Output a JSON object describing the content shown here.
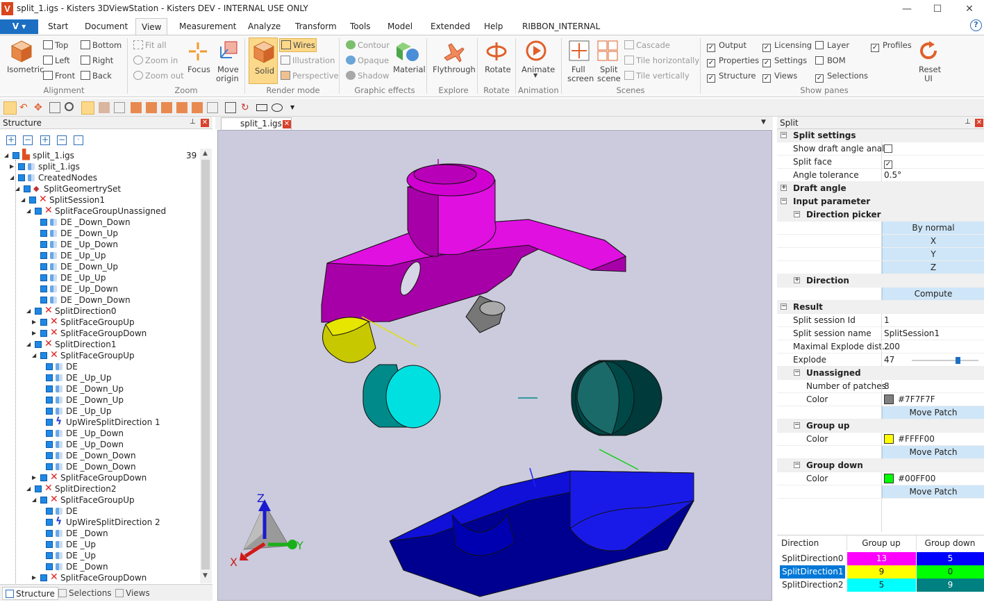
{
  "window": {
    "title": "split_1.igs - Kisters 3DViewStation - Kisters DEV - INTERNAL USE ONLY",
    "app_button": "V",
    "minimize": "—",
    "maximize": "☐",
    "close": "✕"
  },
  "ribbon_tabs": [
    "Start",
    "Document",
    "View",
    "Measurement",
    "Analyze",
    "Transform",
    "Tools",
    "Model",
    "Extended",
    "Help",
    "RIBBON_INTERNAL"
  ],
  "active_tab": "View",
  "help": "?",
  "ribbon": {
    "isometric": "Isometric",
    "top": "Top",
    "bottom": "Bottom",
    "left": "Left",
    "right": "Right",
    "front": "Front",
    "back": "Back",
    "alignment": "Alignment",
    "fit_all": "Fit all",
    "zoom_in": "Zoom in",
    "zoom_out": "Zoom out",
    "focus": "Focus",
    "move_origin_1": "Move",
    "move_origin_2": "origin",
    "zoom": "Zoom",
    "solid": "Solid",
    "wires": "Wires",
    "illustration": "Illustration",
    "perspective": "Perspective",
    "render_mode": "Render mode",
    "contour": "Contour",
    "opaque": "Opaque",
    "shadow": "Shadow",
    "material": "Material",
    "graphic_effects": "Graphic effects",
    "flythrough": "Flythrough",
    "explore": "Explore",
    "rotate": "Rotate",
    "rotate_grp": "Rotate",
    "animate": "Animate",
    "animation": "Animation",
    "full_screen_1": "Full",
    "full_screen_2": "screen",
    "split_scene_1": "Split",
    "split_scene_2": "scene",
    "cascade": "Cascade",
    "tile_h": "Tile horizontally",
    "tile_v": "Tile vertically",
    "scenes": "Scenes",
    "output": "Output",
    "licensing": "Licensing",
    "layer": "Layer",
    "profiles": "Profiles",
    "properties": "Properties",
    "settings": "Settings",
    "bom": "BOM",
    "structure": "Structure",
    "views": "Views",
    "selections": "Selections",
    "reset_1": "Reset",
    "reset_2": "UI",
    "show_panes": "Show panes",
    "checks": {
      "output": true,
      "licensing": true,
      "layer": false,
      "profiles": true,
      "properties": true,
      "settings": true,
      "bom": false,
      "structure": true,
      "views": true,
      "selections": true
    }
  },
  "structure_panel": {
    "title": "Structure",
    "pin": "⊥",
    "close": "✕",
    "tree": [
      {
        "label": "split_1.igs",
        "count": "39"
      },
      {
        "label": "split_1.igs"
      },
      {
        "label": "CreatedNodes"
      },
      {
        "label": "SplitGeomertrySet"
      },
      {
        "label": "SplitSession1"
      },
      {
        "label": "SplitFaceGroupUnassigned"
      },
      {
        "label": "DE     _Down_Down"
      },
      {
        "label": "DE     _Down_Up"
      },
      {
        "label": "DE     _Up_Down"
      },
      {
        "label": "DE     _Up_Up"
      },
      {
        "label": "DE     _Down_Up"
      },
      {
        "label": "DE     _Up_Up"
      },
      {
        "label": "DE     _Up_Down"
      },
      {
        "label": "DE     _Down_Down"
      },
      {
        "label": "SplitDirection0"
      },
      {
        "label": "SplitFaceGroupUp"
      },
      {
        "label": "SplitFaceGroupDown"
      },
      {
        "label": "SplitDirection1"
      },
      {
        "label": "SplitFaceGroupUp"
      },
      {
        "label": "DE"
      },
      {
        "label": "DE     _Up_Up"
      },
      {
        "label": "DE     _Down_Up"
      },
      {
        "label": "DE     _Down_Up"
      },
      {
        "label": "DE     _Up_Up"
      },
      {
        "label": "UpWireSplitDirection 1"
      },
      {
        "label": "DE     _Up_Down"
      },
      {
        "label": "DE     _Up_Down"
      },
      {
        "label": "DE     _Down_Down"
      },
      {
        "label": "DE     _Down_Down"
      },
      {
        "label": "SplitFaceGroupDown"
      },
      {
        "label": "SplitDirection2"
      },
      {
        "label": "SplitFaceGroupUp"
      },
      {
        "label": "DE"
      },
      {
        "label": "UpWireSplitDirection 2"
      },
      {
        "label": "DE     _Down"
      },
      {
        "label": "DE     _Up"
      },
      {
        "label": "DE     _Up"
      },
      {
        "label": "DE     _Down"
      },
      {
        "label": "SplitFaceGroupDown"
      }
    ],
    "bottom_tabs": [
      "Structure",
      "Selections",
      "Views"
    ]
  },
  "document": {
    "tab": "split_1.igs",
    "close": "✕",
    "dropdown": "▼"
  },
  "axis_triad": {
    "x": "X",
    "y": "Y",
    "z": "Z"
  },
  "split_panel": {
    "title": "Split",
    "split_settings": "Split settings",
    "show_draft_label": "Show draft angle anal…",
    "show_draft_checked": false,
    "split_face_label": "Split face",
    "split_face_checked": true,
    "angle_tolerance_label": "Angle tolerance",
    "angle_tolerance": "0.5°",
    "draft_angle": "Draft angle",
    "input_parameter": "Input parameter",
    "direction_picker": "Direction picker",
    "by_normal": "By normal",
    "x": "X",
    "y": "Y",
    "z": "Z",
    "direction": "Direction",
    "compute": "Compute",
    "result": "Result",
    "session_id_label": "Split session Id",
    "session_id": "1",
    "session_name_label": "Split session name",
    "session_name": "SplitSession1",
    "max_explode_label": "Maximal Explode dist…",
    "max_explode": "200",
    "explode_label": "Explode",
    "explode_value": "47",
    "explode_fraction": 0.235,
    "unassigned": "Unassigned",
    "patches_label": "Number of patches",
    "patches": "8",
    "color_label": "Color",
    "unassigned_color": "#7F7F7F",
    "move_patch": "Move Patch",
    "group_up": "Group up",
    "group_up_color": "#FFFF00",
    "group_down": "Group down",
    "group_down_color": "#00FF00"
  },
  "result_table": {
    "headers": [
      "Direction",
      "Group up",
      "Group down"
    ],
    "rows": [
      {
        "direction": "SplitDirection0",
        "up": "13",
        "down": "5",
        "up_color": "#ff00ff",
        "down_color": "#0000ff"
      },
      {
        "direction": "SplitDirection1",
        "up": "9",
        "down": "0",
        "up_color": "#ffff00",
        "down_color": "#00ff00"
      },
      {
        "direction": "SplitDirection2",
        "up": "5",
        "down": "9",
        "up_color": "#00ffff",
        "down_color": "#008080"
      }
    ],
    "selected_row": 1
  }
}
